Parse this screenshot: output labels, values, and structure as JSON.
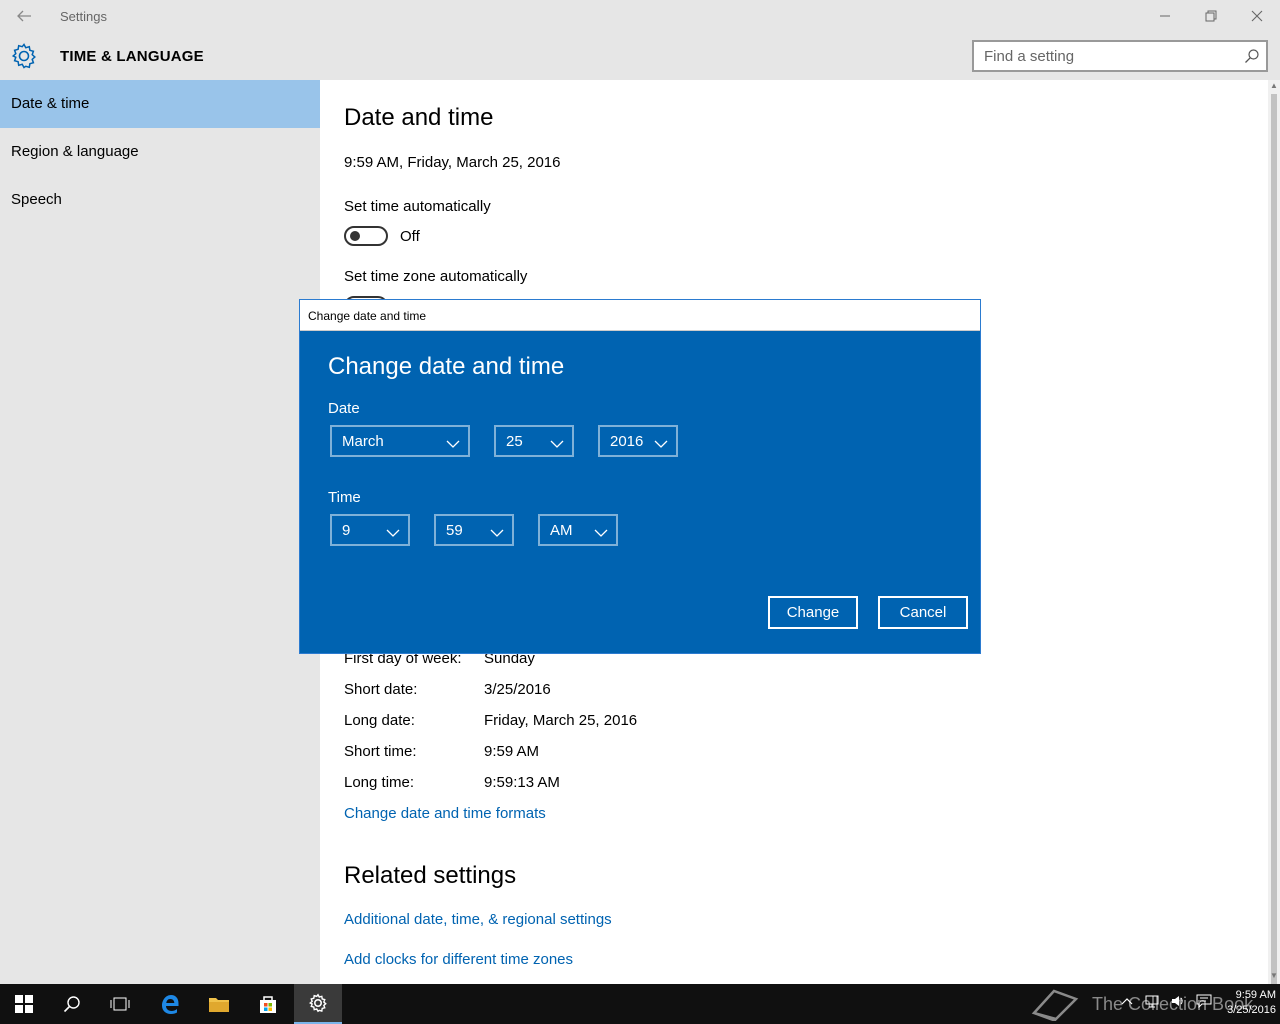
{
  "window": {
    "title": "Settings",
    "section": "TIME & LANGUAGE",
    "search_placeholder": "Find a setting"
  },
  "sidebar": {
    "items": [
      {
        "label": "Date & time"
      },
      {
        "label": "Region & language"
      },
      {
        "label": "Speech"
      }
    ]
  },
  "main": {
    "page_title": "Date and time",
    "current_datetime": "9:59 AM, Friday, March 25, 2016",
    "set_time_auto_label": "Set time automatically",
    "set_time_auto_state": "Off",
    "set_tz_auto_label": "Set time zone automatically",
    "formats": [
      {
        "label": "First day of week:",
        "value": "Sunday"
      },
      {
        "label": "Short date:",
        "value": "3/25/2016"
      },
      {
        "label": "Long date:",
        "value": "Friday, March 25, 2016"
      },
      {
        "label": "Short time:",
        "value": "9:59 AM"
      },
      {
        "label": "Long time:",
        "value": "9:59:13 AM"
      }
    ],
    "change_formats_link": "Change date and time formats",
    "related_title": "Related settings",
    "related_links": [
      "Additional date, time, & regional settings",
      "Add clocks for different time zones"
    ]
  },
  "dialog": {
    "window_title": "Change date and time",
    "heading": "Change date and time",
    "date_label": "Date",
    "month": "March",
    "day": "25",
    "year": "2016",
    "time_label": "Time",
    "hour": "9",
    "minute": "59",
    "ampm": "AM",
    "change_button": "Change",
    "cancel_button": "Cancel"
  },
  "taskbar": {
    "clock_time": "9:59 AM",
    "clock_date": "3/25/2016",
    "watermark": "The Collection Book"
  },
  "colors": {
    "accent": "#0063b1",
    "selected_nav": "#99c4ea",
    "link": "#0063b1"
  }
}
